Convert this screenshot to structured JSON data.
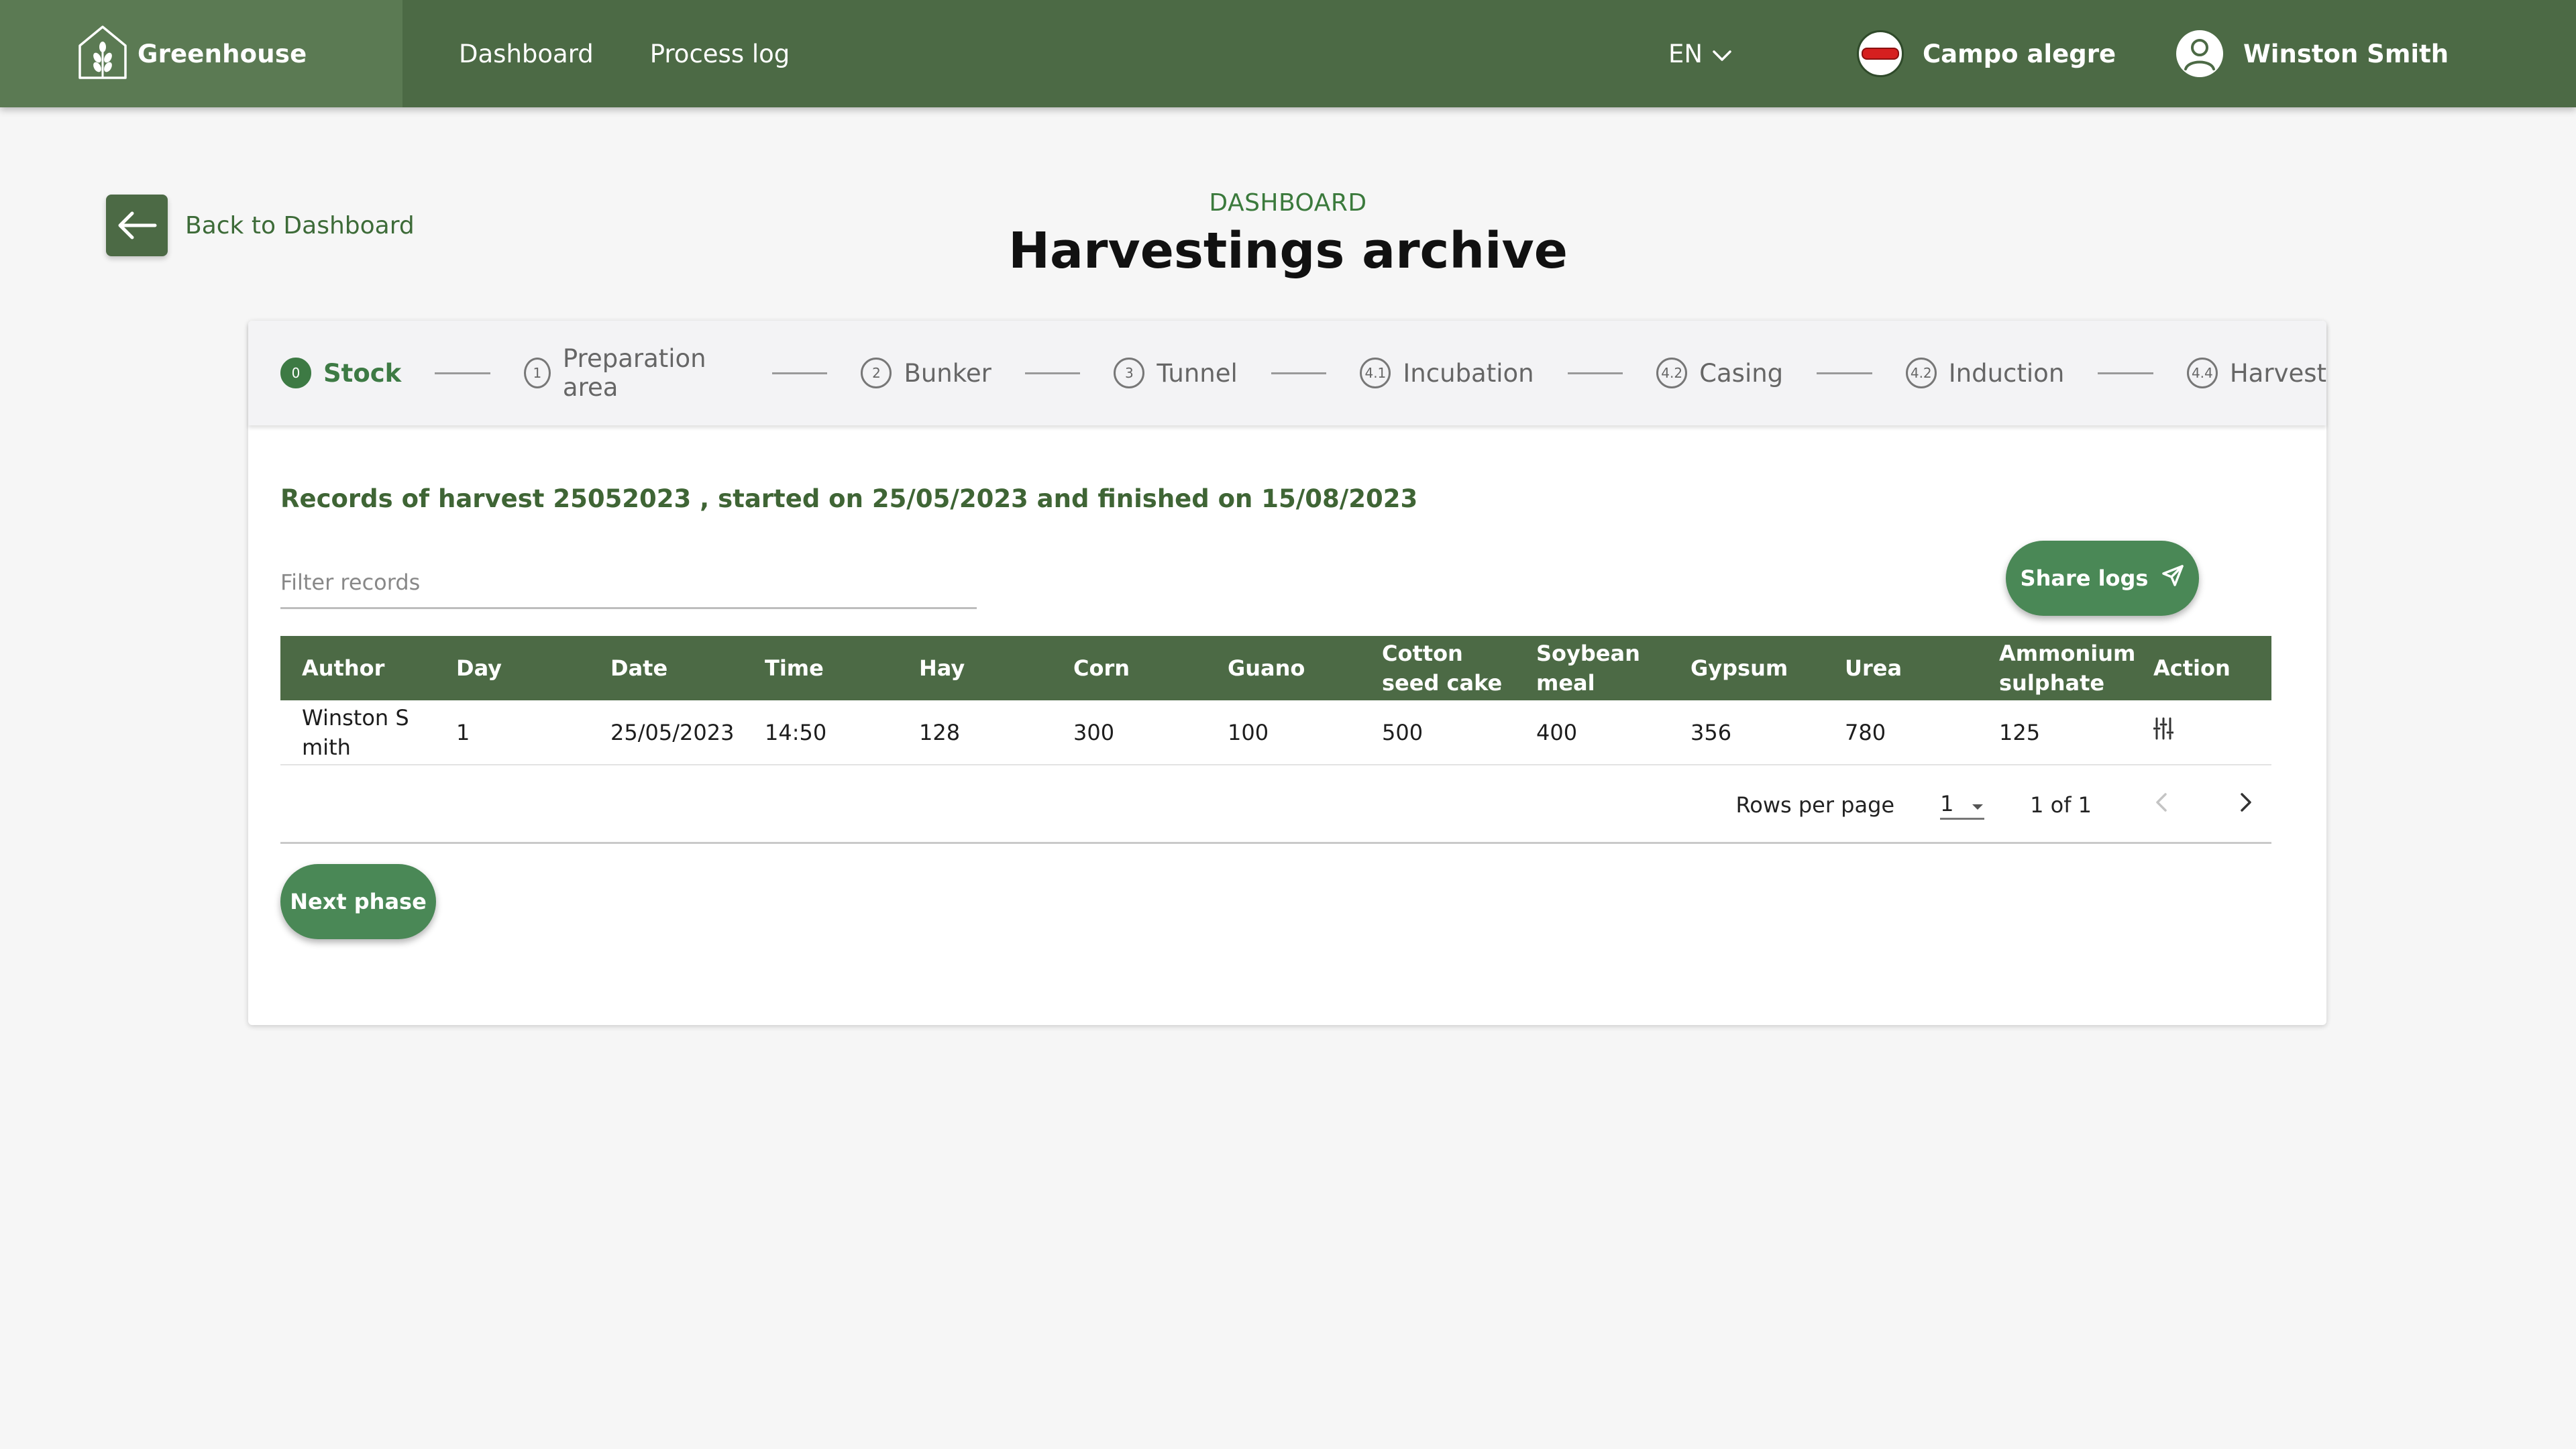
{
  "app": {
    "brand": "Greenhouse",
    "nav": [
      "Dashboard",
      "Process log"
    ],
    "language": "EN",
    "farm": "Campo alegre",
    "user": "Winston Smith"
  },
  "colors": {
    "primary": "#4c6a45",
    "accent": "#4a8856",
    "active_step": "#3d7a44"
  },
  "back_label": "Back to Dashboard",
  "header": {
    "overline": "DASHBOARD",
    "title": "Harvestings archive"
  },
  "steps": [
    {
      "num": "0",
      "label": "Stock",
      "active": true
    },
    {
      "num": "1",
      "label": "Preparation area"
    },
    {
      "num": "2",
      "label": "Bunker"
    },
    {
      "num": "3",
      "label": "Tunnel"
    },
    {
      "num": "4.1",
      "label": "Incubation"
    },
    {
      "num": "4.2",
      "label": "Casing"
    },
    {
      "num": "4.2",
      "label": "Induction"
    },
    {
      "num": "4.4",
      "label": "Harvest"
    }
  ],
  "records_title": "Records of harvest 25052023 , started on 25/05/2023 and finished on 15/08/2023",
  "filter": {
    "placeholder": "Filter records",
    "value": ""
  },
  "share_label": "Share logs",
  "table": {
    "columns": [
      "Author",
      "Day",
      "Date",
      "Time",
      "Hay",
      "Corn",
      "Guano",
      "Cotton seed cake",
      "Soybean meal",
      "Gypsum",
      "Urea",
      "Ammonium sulphate",
      "Action"
    ],
    "rows": [
      [
        "Winston Smith",
        "1",
        "25/05/2023",
        "14:50",
        "128",
        "300",
        "100",
        "500",
        "400",
        "356",
        "780",
        "125"
      ]
    ]
  },
  "pagination": {
    "rows_per_page_label": "Rows per page",
    "rows_per_page": "1",
    "range": "1 of 1"
  },
  "next_phase_label": "Next phase"
}
